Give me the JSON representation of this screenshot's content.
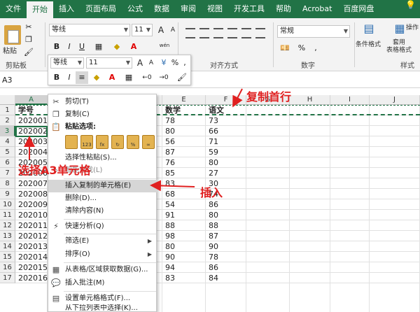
{
  "ribbon_tabs": [
    "文件",
    "开始",
    "插入",
    "页面布局",
    "公式",
    "数据",
    "审阅",
    "视图",
    "开发工具",
    "帮助",
    "Acrobat",
    "百度网盘"
  ],
  "ribbon_tabs_active": "开始",
  "ribbon": {
    "paste_label": "粘贴",
    "clipboard_group": "剪贴板",
    "font_name": "等线",
    "font_size": "11",
    "bold": "B",
    "italic": "I",
    "underline": "U",
    "grow_font": "A",
    "shrink_font": "A",
    "phonetic": "wén",
    "align_group": "对齐方式",
    "number_format": "常规",
    "number_group": "数字",
    "percent": "%",
    "comma": ",",
    "conditional_format": "条件格式",
    "format_table": "套用\n表格格式",
    "style_group": "样式",
    "operate": "操作"
  },
  "name_box": "A3",
  "columns": [
    "A",
    "B",
    "C",
    "D",
    "E",
    "F",
    "G",
    "H",
    "I",
    "J"
  ],
  "rows": [
    "1",
    "2",
    "3",
    "4",
    "5",
    "6",
    "7",
    "8",
    "9",
    "10",
    "11",
    "12",
    "13",
    "14",
    "15",
    "16",
    "17"
  ],
  "sheet": {
    "header": {
      "A": "学号",
      "E": "数学",
      "F": "语文"
    },
    "col_a": [
      "202001",
      "202002",
      "202003",
      "202004",
      "202005",
      "202006",
      "202007",
      "202008",
      "202009",
      "202010",
      "202011",
      "202012",
      "202013",
      "202014",
      "202015",
      "202016"
    ],
    "col_e": [
      "78",
      "80",
      "56",
      "87",
      "76",
      "85",
      "83",
      "68",
      "54",
      "91",
      "88",
      "98",
      "80",
      "90",
      "94",
      "83"
    ],
    "col_f": [
      "73",
      "66",
      "71",
      "59",
      "80",
      "27",
      "30",
      "74",
      "86",
      "80",
      "88",
      "87",
      "90",
      "78",
      "86",
      "84"
    ]
  },
  "mini_toolbar": {
    "font_name": "等线",
    "font_size": "11",
    "grow": "A",
    "shrink": "A",
    "percent": "%",
    "comma": ","
  },
  "context_menu": {
    "cut": "剪切(T)",
    "copy": "复制(C)",
    "paste_options": "粘贴选项:",
    "paste_special": "选择性粘贴(S)...",
    "smart_lookup": "智能查找(L)",
    "insert_copied": "插入复制的单元格(E)",
    "delete": "删除(D)...",
    "clear": "清除内容(N)",
    "quick_analysis": "快速分析(Q)",
    "filter": "筛选(E)",
    "sort": "排序(O)",
    "get_data": "从表格/区域获取数据(G)...",
    "insert_comment": "插入批注(M)",
    "format_cells": "设置单元格格式(F)...",
    "pick_list": "从下拉列表中选择(K)...",
    "arrow": "▶"
  },
  "annotations": {
    "copy_first_row": "复制首行",
    "select_a3": "选择A3单元格",
    "insert": "插入"
  },
  "colors": {
    "excel_green": "#217346",
    "annotation_red": "#e02020",
    "highlight": "#d6d6d6"
  }
}
